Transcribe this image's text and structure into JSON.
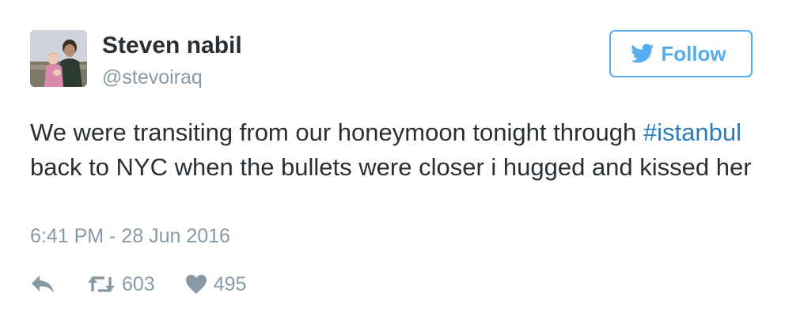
{
  "user": {
    "display_name": "Steven nabil",
    "screen_name": "@stevoiraq",
    "avatar_icon": "profile-photo"
  },
  "follow_button": {
    "label": "Follow",
    "icon": "twitter-bird-icon",
    "color": "#55acee"
  },
  "tweet": {
    "text_part1": "We were transiting from our honeymoon tonight through ",
    "hashtag": "#istanbul",
    "text_part2": " back to NYC when the bullets were closer i hugged and kissed her",
    "hashtag_color": "#2b7bb9",
    "timestamp": "6:41 PM - 28 Jun 2016"
  },
  "actions": {
    "reply_icon": "reply-icon",
    "retweet_icon": "retweet-icon",
    "retweet_count": "603",
    "like_icon": "heart-icon",
    "like_count": "495"
  }
}
